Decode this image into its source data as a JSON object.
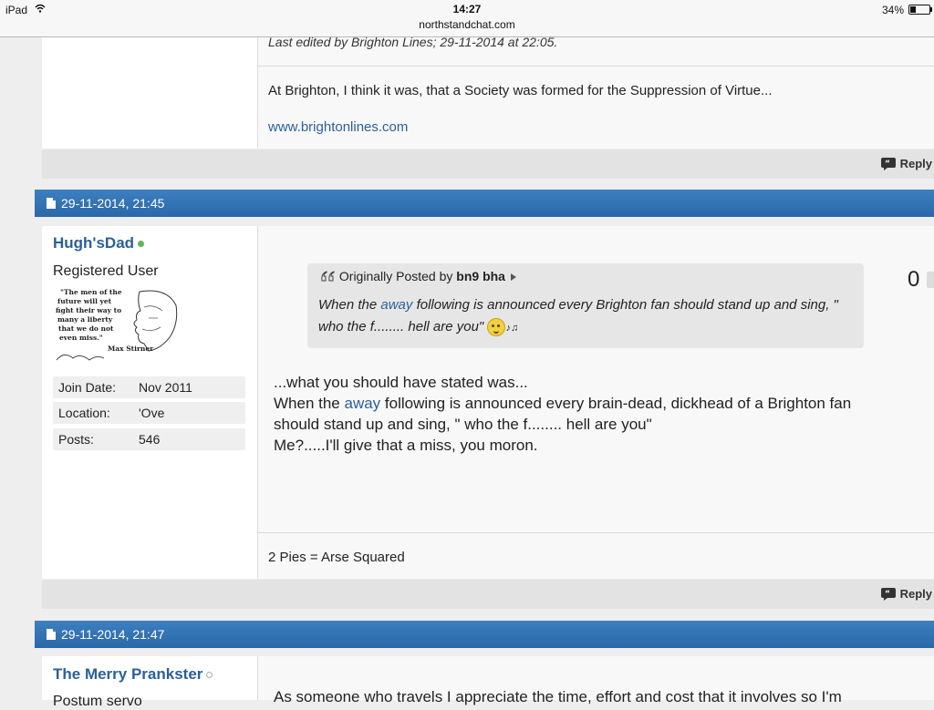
{
  "statusbar": {
    "device": "iPad",
    "time": "14:27",
    "url": "northstandchat.com",
    "battery": "34%",
    "battery_level": 0.34
  },
  "post1": {
    "edited_note": "Last edited by Brighton Lines; 29-11-2014 at 22:05.",
    "signature_text": "At Brighton, I think it was, that a Society was formed for the Suppression of Virtue...",
    "signature_link": "www.brightonlines.com",
    "reply_label": "Reply"
  },
  "post2": {
    "date": "29-11-2014, 21:45",
    "username": "Hugh'sDad",
    "online_color": "#5cb85c",
    "user_title": "Registered User",
    "avatar_text": [
      "\"The men of the",
      "future will yet",
      "fight their way to",
      "many a liberty",
      "that we do not",
      "even miss.\"",
      "Max Stirner"
    ],
    "info": [
      {
        "label": "Join Date:",
        "value": "Nov 2011"
      },
      {
        "label": "Location:",
        "value": "'Ove"
      },
      {
        "label": "Posts:",
        "value": "546"
      }
    ],
    "rep": "0",
    "quote": {
      "prefix": "Originally Posted by",
      "author": "bn9 bha",
      "text_a": "When the ",
      "link": "away",
      "text_b": " following is announced every Brighton fan should stand up and sing, \" who the f........ hell are you\""
    },
    "message": {
      "line1": "...what you should have stated was...",
      "line2a": "When the ",
      "line2link": "away",
      "line2b": " following is announced every brain-dead, dickhead of a Brighton fan",
      "line3": "should stand up and sing, \" who the f........ hell are you\"",
      "line4": "Me?.....I'll give that a miss, you moron."
    },
    "signature": "2 Pies = Arse Squared",
    "reply_label": "Reply"
  },
  "post3": {
    "date": "29-11-2014, 21:47",
    "username": "The Merry Prankster",
    "online_color": "#aaaaaa",
    "user_title": "Postum servo",
    "message_partial": "As someone who travels I appreciate the time, effort and cost that it involves so I'm"
  },
  "colors": {
    "header_blue": "#2b68a8",
    "link_blue": "#2b5f99"
  }
}
